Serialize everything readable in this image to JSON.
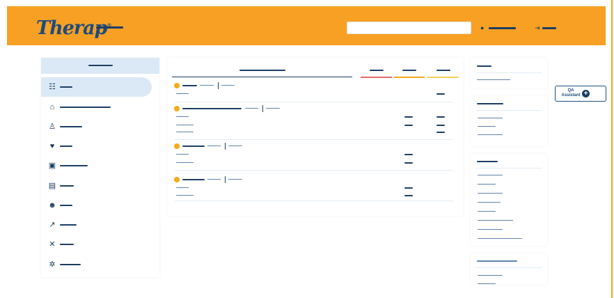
{
  "header": {
    "logo_text": "Therap",
    "logo_mark": "®",
    "search_placeholder": "",
    "user_icon": "user-icon",
    "logout_icon": "logout-icon"
  },
  "sidebar": {
    "items": [
      {
        "icon": "task-list-icon",
        "glyph": "☷",
        "active": true
      },
      {
        "icon": "home-icon",
        "glyph": "⌂",
        "active": false
      },
      {
        "icon": "individual-icon",
        "glyph": "♙",
        "active": false
      },
      {
        "icon": "health-icon",
        "glyph": "♥",
        "active": false
      },
      {
        "icon": "id-card-icon",
        "glyph": "▣",
        "active": false
      },
      {
        "icon": "document-icon",
        "glyph": "▤",
        "active": false
      },
      {
        "icon": "users-icon",
        "glyph": "☻",
        "active": false
      },
      {
        "icon": "chart-icon",
        "glyph": "↗",
        "active": false
      },
      {
        "icon": "tools-icon",
        "glyph": "✕",
        "active": false
      },
      {
        "icon": "settings-icon",
        "glyph": "✲",
        "active": false
      }
    ]
  },
  "colors": {
    "header_bg": "#f7a024",
    "brand_navy": "#1d3e63",
    "accent_red": "#e06a6a",
    "accent_orange": "#f7a91d",
    "accent_yellow": "#f2cf56",
    "active_bg": "#dbe9f6"
  },
  "qa_assistant": {
    "label": "QA Assistant",
    "icon": "plus-circle-icon"
  }
}
